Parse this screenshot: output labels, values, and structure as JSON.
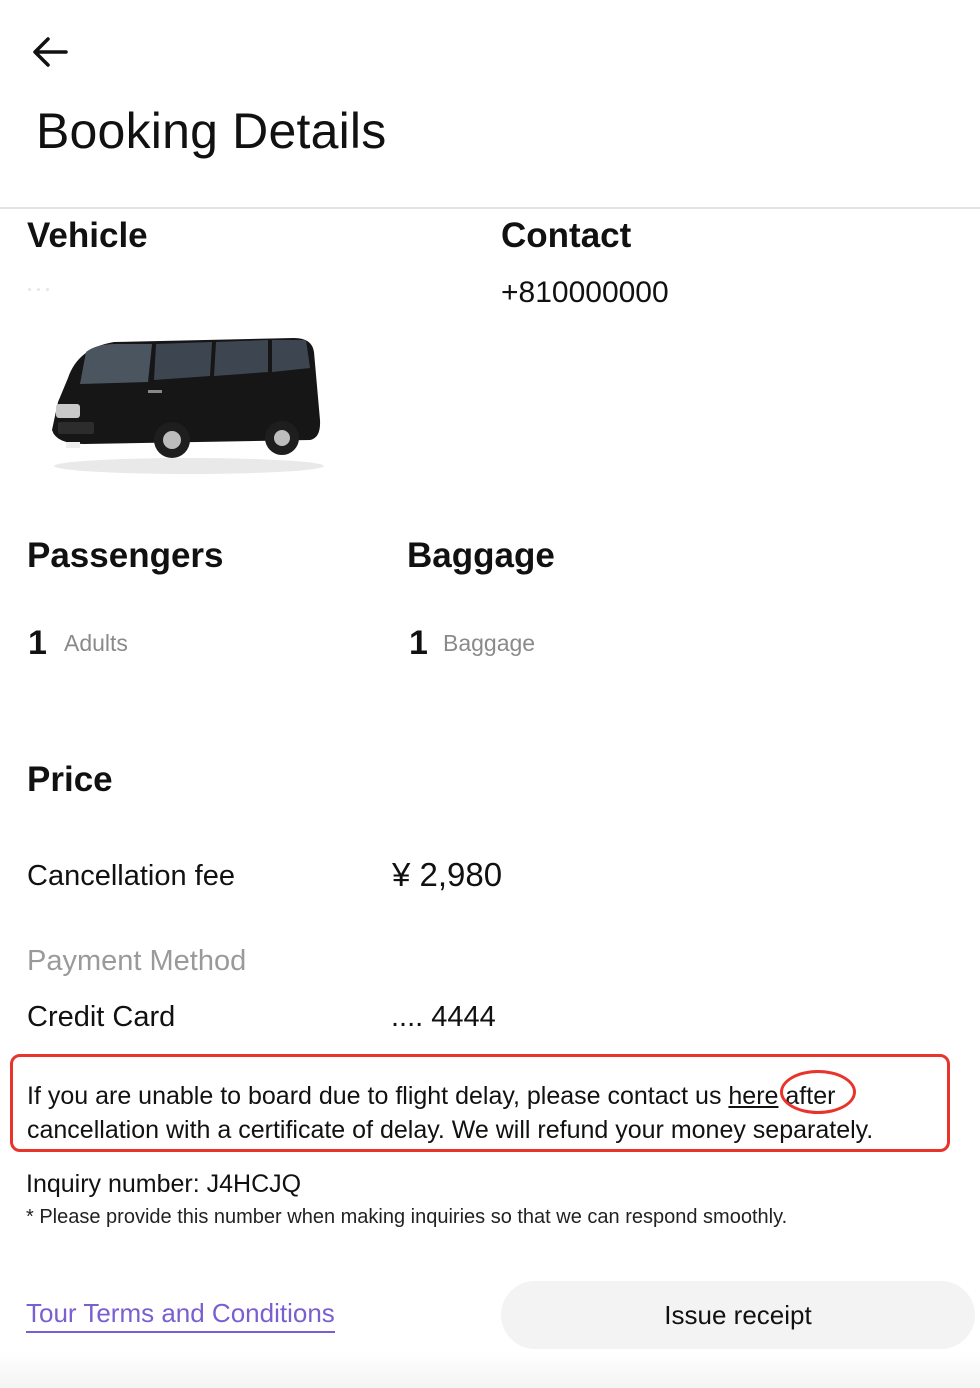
{
  "header": {
    "back_icon": "arrow-left-icon",
    "title": "Booking Details"
  },
  "vehicle": {
    "heading": "Vehicle",
    "image": "black-van-image"
  },
  "contact": {
    "heading": "Contact",
    "phone": "+810000000"
  },
  "passengers": {
    "heading": "Passengers",
    "count": "1",
    "unit": "Adults"
  },
  "baggage": {
    "heading": "Baggage",
    "count": "1",
    "unit": "Baggage"
  },
  "price": {
    "heading": "Price",
    "fee_label": "Cancellation fee",
    "fee_value": "¥ 2,980",
    "payment_method_label": "Payment Method",
    "payment_type": "Credit Card",
    "card_number": ".... 4444"
  },
  "notice": {
    "text_before": "If you are unable to board due to flight delay, please contact us ",
    "link": "here",
    "text_after": " after",
    "line2": "cancellation with a certificate of delay. We will refund your money separately.",
    "highlight_color": "#e8342a"
  },
  "inquiry": {
    "number_line": "Inquiry number: J4HCJQ",
    "note": "* Please provide this number when making inquiries so that we can respond smoothly."
  },
  "footer": {
    "terms_link": "Tour Terms and Conditions",
    "receipt_button": "Issue receipt",
    "link_color": "#7a5fd0"
  }
}
